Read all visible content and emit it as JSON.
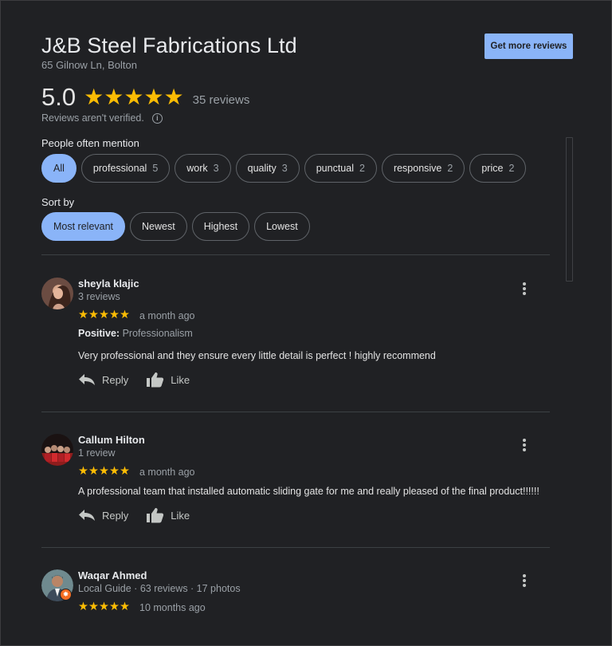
{
  "business": {
    "name": "J&B Steel Fabrications Ltd",
    "address": "65 Gilnow Ln, Bolton",
    "rating": "5.0",
    "stars": "★★★★★",
    "review_count": "35 reviews",
    "not_verified": "Reviews aren't verified."
  },
  "buttons": {
    "get_more_reviews": "Get more reviews"
  },
  "mentions": {
    "label": "People often mention",
    "chips": [
      {
        "label": "All",
        "count": ""
      },
      {
        "label": "professional",
        "count": "5"
      },
      {
        "label": "work",
        "count": "3"
      },
      {
        "label": "quality",
        "count": "3"
      },
      {
        "label": "punctual",
        "count": "2"
      },
      {
        "label": "responsive",
        "count": "2"
      },
      {
        "label": "price",
        "count": "2"
      }
    ]
  },
  "sort": {
    "label": "Sort by",
    "options": [
      "Most relevant",
      "Newest",
      "Highest",
      "Lowest"
    ]
  },
  "reviews": [
    {
      "name": "sheyla klajic",
      "meta": "3 reviews",
      "stars": "★★★★★",
      "when": "a month ago",
      "positive_label": "Positive:",
      "positive_value": "Professionalism",
      "text": "Very professional and they ensure every little detail is perfect ! highly recommend",
      "reply": "Reply",
      "like": "Like"
    },
    {
      "name": "Callum Hilton",
      "meta": "1 review",
      "stars": "★★★★★",
      "when": "a month ago",
      "text": "A professional team that installed automatic sliding gate for me and really pleased of the final product!!!!!!",
      "reply": "Reply",
      "like": "Like"
    },
    {
      "name": "Waqar Ahmed",
      "meta": "Local Guide · 63 reviews · 17 photos",
      "stars": "★★★★★",
      "when": "10 months ago"
    }
  ],
  "colors": {
    "background": "#202124",
    "accent": "#8ab4f8",
    "star": "#fbbc04",
    "muted_text": "#9aa0a6",
    "local_guide_badge": "#f46d22"
  }
}
